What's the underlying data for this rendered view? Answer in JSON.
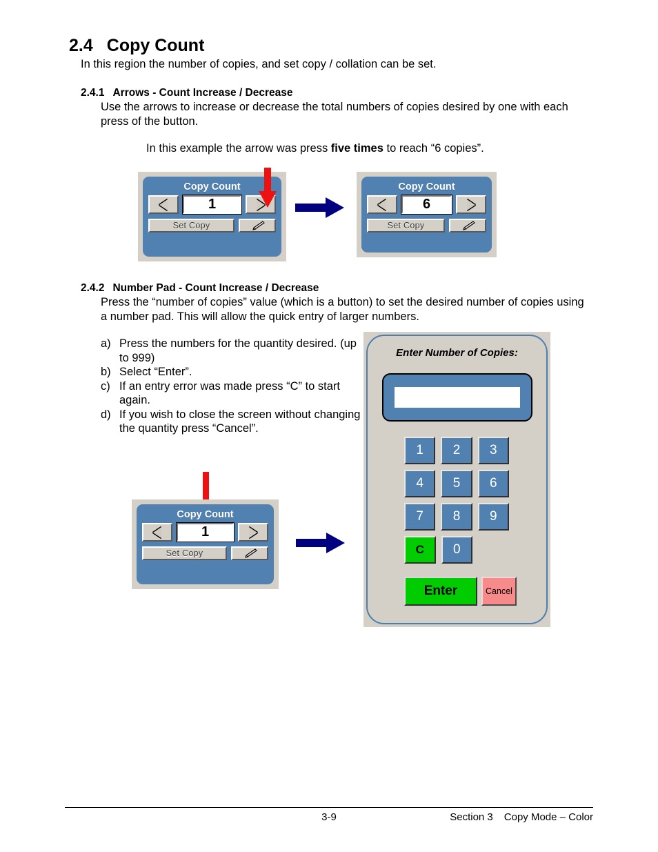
{
  "document": {
    "section_heading": {
      "number": "2.4",
      "title": "Copy Count"
    },
    "intro": "In this region the number of copies, and set copy / collation can be set.",
    "subsection_241": {
      "number": "2.4.1",
      "title": "Arrows -  Count Increase / Decrease",
      "body": "Use the arrows to increase or decrease the total numbers of copies desired by one with each press of the button.",
      "example_prefix": "In this example the arrow was press ",
      "example_bold": "five times",
      "example_suffix": " to reach “6 copies”."
    },
    "subsection_242": {
      "number": "2.4.2",
      "title": "Number Pad - Count Increase / Decrease",
      "body": "Press the “number of copies” value (which is a button) to set the desired number of copies using a number pad. This will allow the quick entry of larger numbers.",
      "steps": [
        {
          "marker": "a)",
          "text": "Press the numbers for the quantity desired. (up to 999)"
        },
        {
          "marker": "b)",
          "text": "Select “Enter”."
        },
        {
          "marker": "c)",
          "text": "If an entry error was made press “C” to start again."
        },
        {
          "marker": "d)",
          "text": "If you wish to close the screen without changing the quantity press “Cancel”."
        }
      ]
    }
  },
  "copy_count_widget_1": {
    "title": "Copy Count",
    "value": "1",
    "set_copy_label": "Set Copy",
    "decrease_icon": "left-triangle-icon",
    "increase_icon": "right-triangle-icon",
    "edit_icon": "pencil-icon"
  },
  "copy_count_widget_2": {
    "title": "Copy Count",
    "value": "6",
    "set_copy_label": "Set Copy",
    "decrease_icon": "left-triangle-icon",
    "increase_icon": "right-triangle-icon",
    "edit_icon": "pencil-icon"
  },
  "copy_count_widget_3": {
    "title": "Copy Count",
    "value": "1",
    "set_copy_label": "Set Copy",
    "decrease_icon": "left-triangle-icon",
    "increase_icon": "right-triangle-icon",
    "edit_icon": "pencil-icon"
  },
  "number_pad": {
    "title": "Enter Number of Copies:",
    "display_value": "",
    "keys": [
      [
        "1",
        "2",
        "3"
      ],
      [
        "4",
        "5",
        "6"
      ],
      [
        "7",
        "8",
        "9"
      ],
      [
        "C",
        "0",
        ""
      ]
    ],
    "clear_label": "C",
    "enter_label": "Enter",
    "cancel_label": "Cancel"
  },
  "footer": {
    "page_number": "3-9",
    "section": "Section 3",
    "chapter": "Copy Mode – Color"
  },
  "colors": {
    "panel_blue": "#5081b1",
    "panel_beige": "#d4d0c8",
    "green": "#00cc00",
    "pink": "#f78a8a",
    "navy_arrow": "#000080",
    "red_arrow": "#ee1111"
  }
}
